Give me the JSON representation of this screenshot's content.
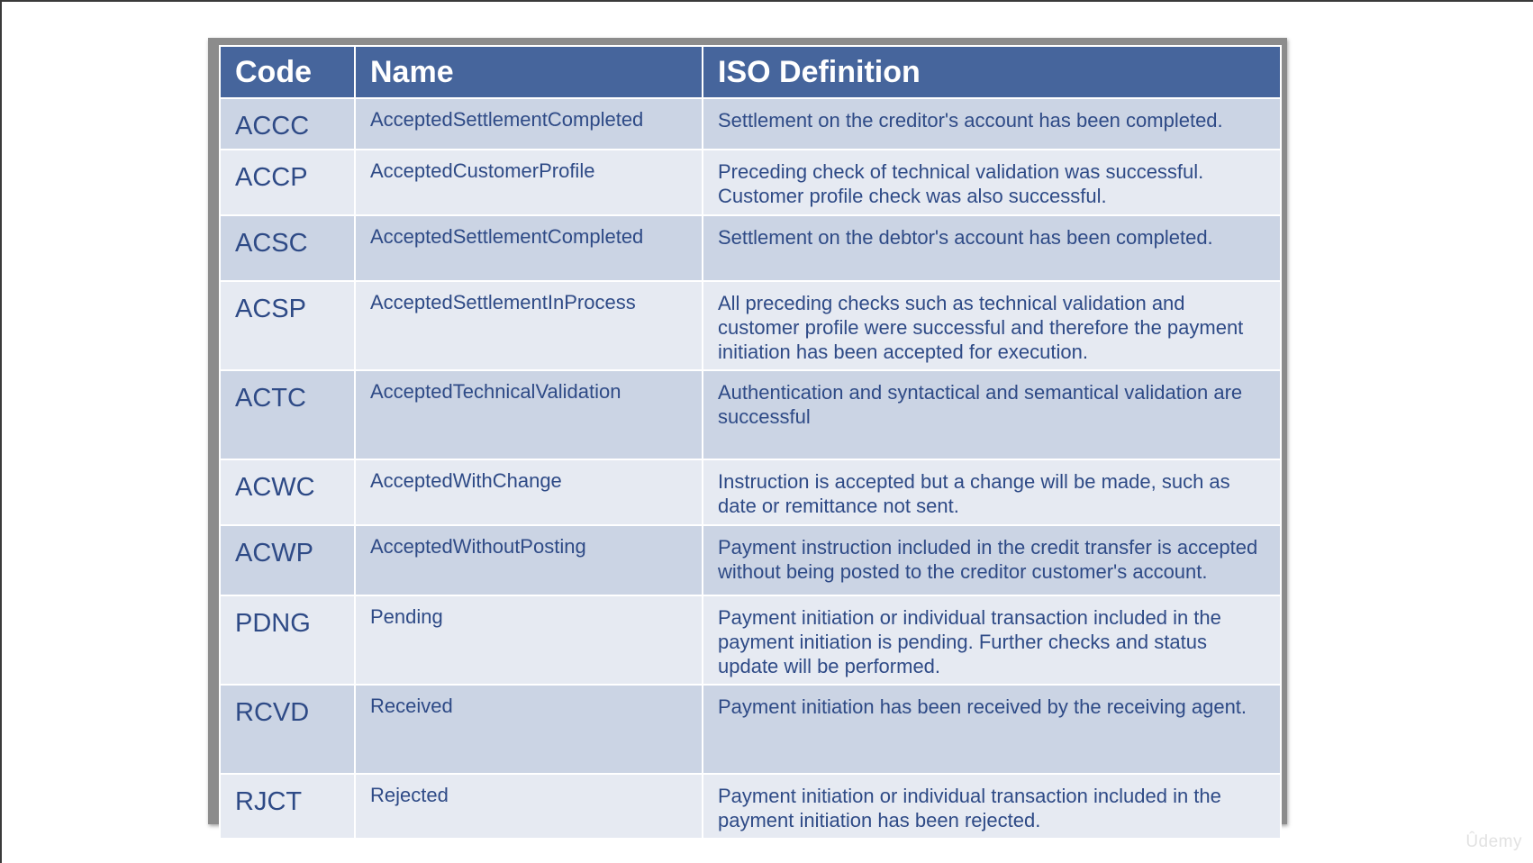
{
  "table": {
    "headers": {
      "code": "Code",
      "name": "Name",
      "definition": "ISO Definition"
    },
    "rows": [
      {
        "code": "ACCC",
        "name": "AcceptedSettlementCompleted",
        "definition": "Settlement on the creditor's account has been completed."
      },
      {
        "code": "ACCP",
        "name": "AcceptedCustomerProfile",
        "definition": "Preceding check of technical validation was successful. Customer profile check was also successful."
      },
      {
        "code": "ACSC",
        "name": "AcceptedSettlementCompleted",
        "definition": "Settlement on the debtor's account has been completed."
      },
      {
        "code": "ACSP",
        "name": "AcceptedSettlementInProcess",
        "definition": "All preceding checks such as technical validation and customer profile were successful and therefore the payment initiation has been accepted for execution."
      },
      {
        "code": "ACTC",
        "name": "AcceptedTechnicalValidation",
        "definition": "Authentication and syntactical and semantical validation are successful"
      },
      {
        "code": "ACWC",
        "name": "AcceptedWithChange",
        "definition": "Instruction is accepted but a change will be made, such as date or remittance not sent."
      },
      {
        "code": "ACWP",
        "name": "AcceptedWithoutPosting",
        "definition": "Payment instruction included in the credit transfer is accepted without being posted to the creditor customer's account."
      },
      {
        "code": "PDNG",
        "name": "Pending",
        "definition": "Payment initiation or individual transaction included in the payment initiation is pending. Further checks and status update will be performed."
      },
      {
        "code": "RCVD",
        "name": "Received",
        "definition": "Payment initiation has been received by the receiving agent."
      },
      {
        "code": "RJCT",
        "name": "Rejected",
        "definition": "Payment initiation or individual transaction included in the payment initiation has been rejected."
      }
    ]
  },
  "watermark": "Ûdemy",
  "colors": {
    "header_bg": "#46659c",
    "row_dark": "#cbd4e4",
    "row_light": "#e6eaf2",
    "text": "#2e4a86"
  }
}
